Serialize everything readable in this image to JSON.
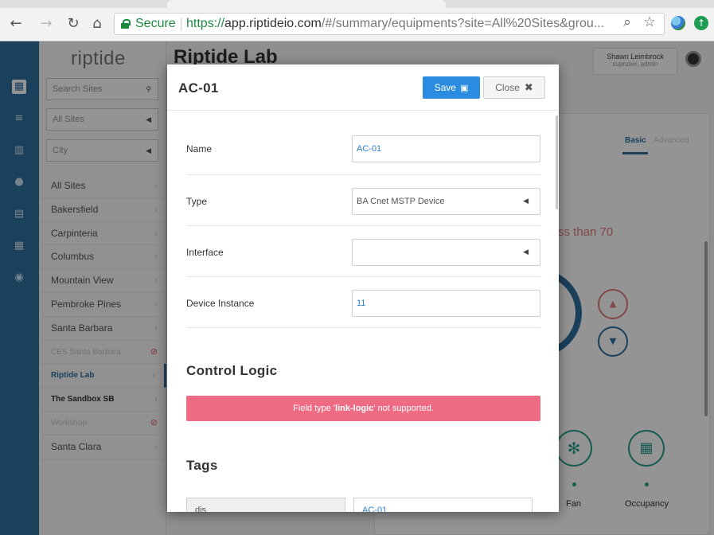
{
  "browser": {
    "secure_label": "Secure",
    "url_scheme": "https://",
    "url_host": "app.riptideio.com",
    "url_path": "/#/summary/equipments?site=All%20Sites&grou..."
  },
  "app": {
    "logo": "riptide",
    "page_title": "Riptide Lab",
    "user_name": "Shawn Leimbrock",
    "user_role": "supruser, admin",
    "search_placeholder": "Search Sites",
    "filter_all_sites": "All Sites",
    "filter_city": "City",
    "sites": [
      {
        "label": "All Sites",
        "state": "normal"
      },
      {
        "label": "Bakersfield",
        "state": "normal"
      },
      {
        "label": "Carpinteria",
        "state": "normal"
      },
      {
        "label": "Columbus",
        "state": "normal"
      },
      {
        "label": "Mountain View",
        "state": "normal"
      },
      {
        "label": "Pembroke Pines",
        "state": "normal"
      },
      {
        "label": "Santa Barbara",
        "state": "normal"
      },
      {
        "label": "CES Santa Barbara",
        "state": "disabled"
      },
      {
        "label": "Riptide Lab",
        "state": "active"
      },
      {
        "label": "The Sandbox SB",
        "state": "strong"
      },
      {
        "label": "Workshop",
        "state": "disabled"
      },
      {
        "label": "Santa Clara",
        "state": "normal"
      }
    ],
    "panel": {
      "tab_basic": "Basic",
      "tab_advanced": "Advanced",
      "condition_text": "ss than 70",
      "fan_label": "Fan",
      "occupancy_label": "Occupancy"
    }
  },
  "modal": {
    "title": "AC-01",
    "save_label": "Save",
    "close_label": "Close",
    "fields": {
      "name_label": "Name",
      "name_value": "AC-01",
      "type_label": "Type",
      "type_value": "BA Cnet MSTP Device",
      "interface_label": "Interface",
      "interface_value": "",
      "device_instance_label": "Device Instance",
      "device_instance_value": "11"
    },
    "control_logic_heading": "Control Logic",
    "error_prefix": "Field type '",
    "error_field": "link-logic",
    "error_suffix": "' not supported.",
    "tags_heading": "Tags",
    "tag_key": "dis",
    "tag_value": "AC-01"
  },
  "colors": {
    "primary": "#2a8ce0",
    "rail": "#2f6f9f",
    "error": "#ef6b84",
    "secure_green": "#1b8a3e"
  }
}
